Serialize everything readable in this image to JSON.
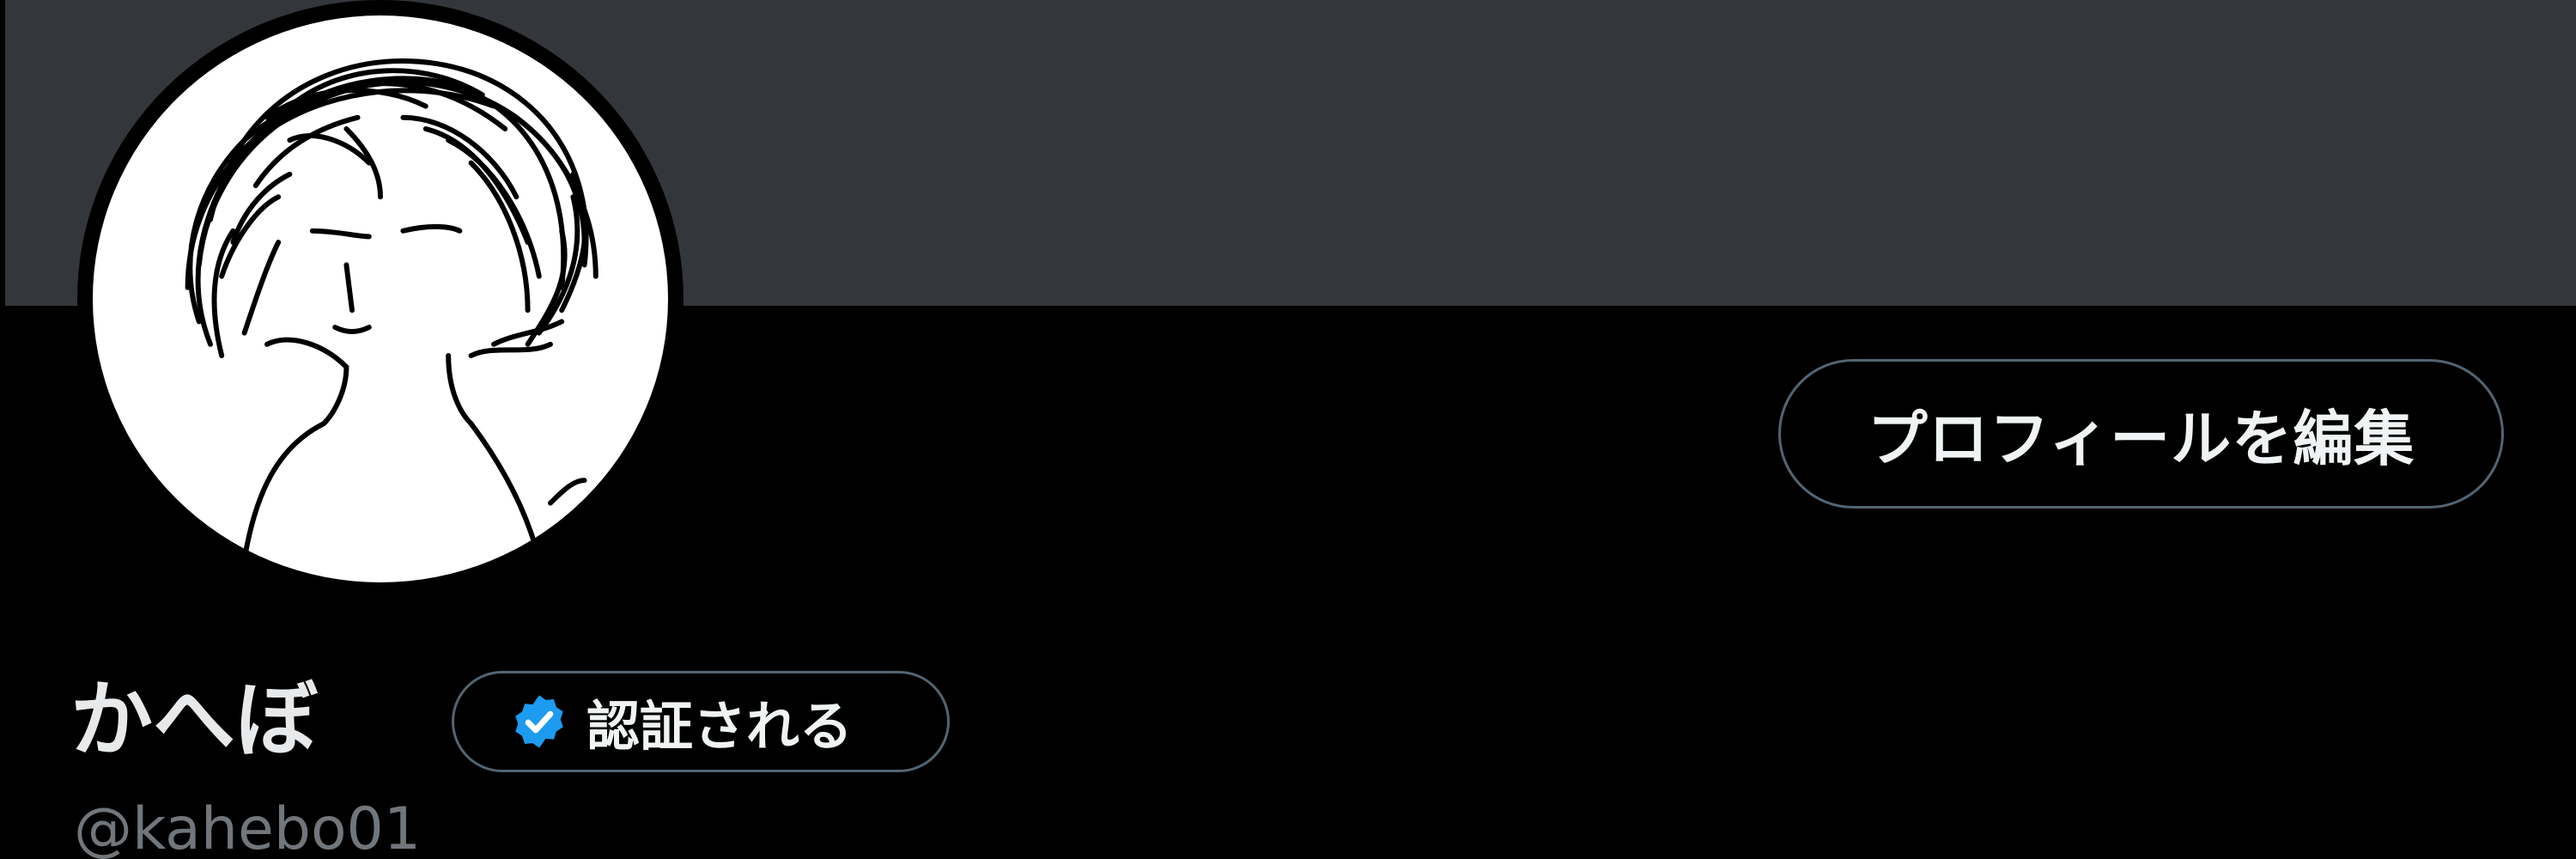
{
  "colors": {
    "banner": "#33363b",
    "background": "#000000",
    "button_border": "#536471",
    "text_primary": "#e7e9ea",
    "text_secondary": "#71767b",
    "verified_blue": "#1d9bf0"
  },
  "header": {
    "banner_icon": "banner-image"
  },
  "profile": {
    "avatar_icon": "sketch-avatar",
    "edit_button_label": "プロフィールを編集",
    "display_name": "かへぼ",
    "verify_button": {
      "icon": "verified-badge-icon",
      "label": "認証される"
    },
    "handle": "@kahebo01"
  }
}
